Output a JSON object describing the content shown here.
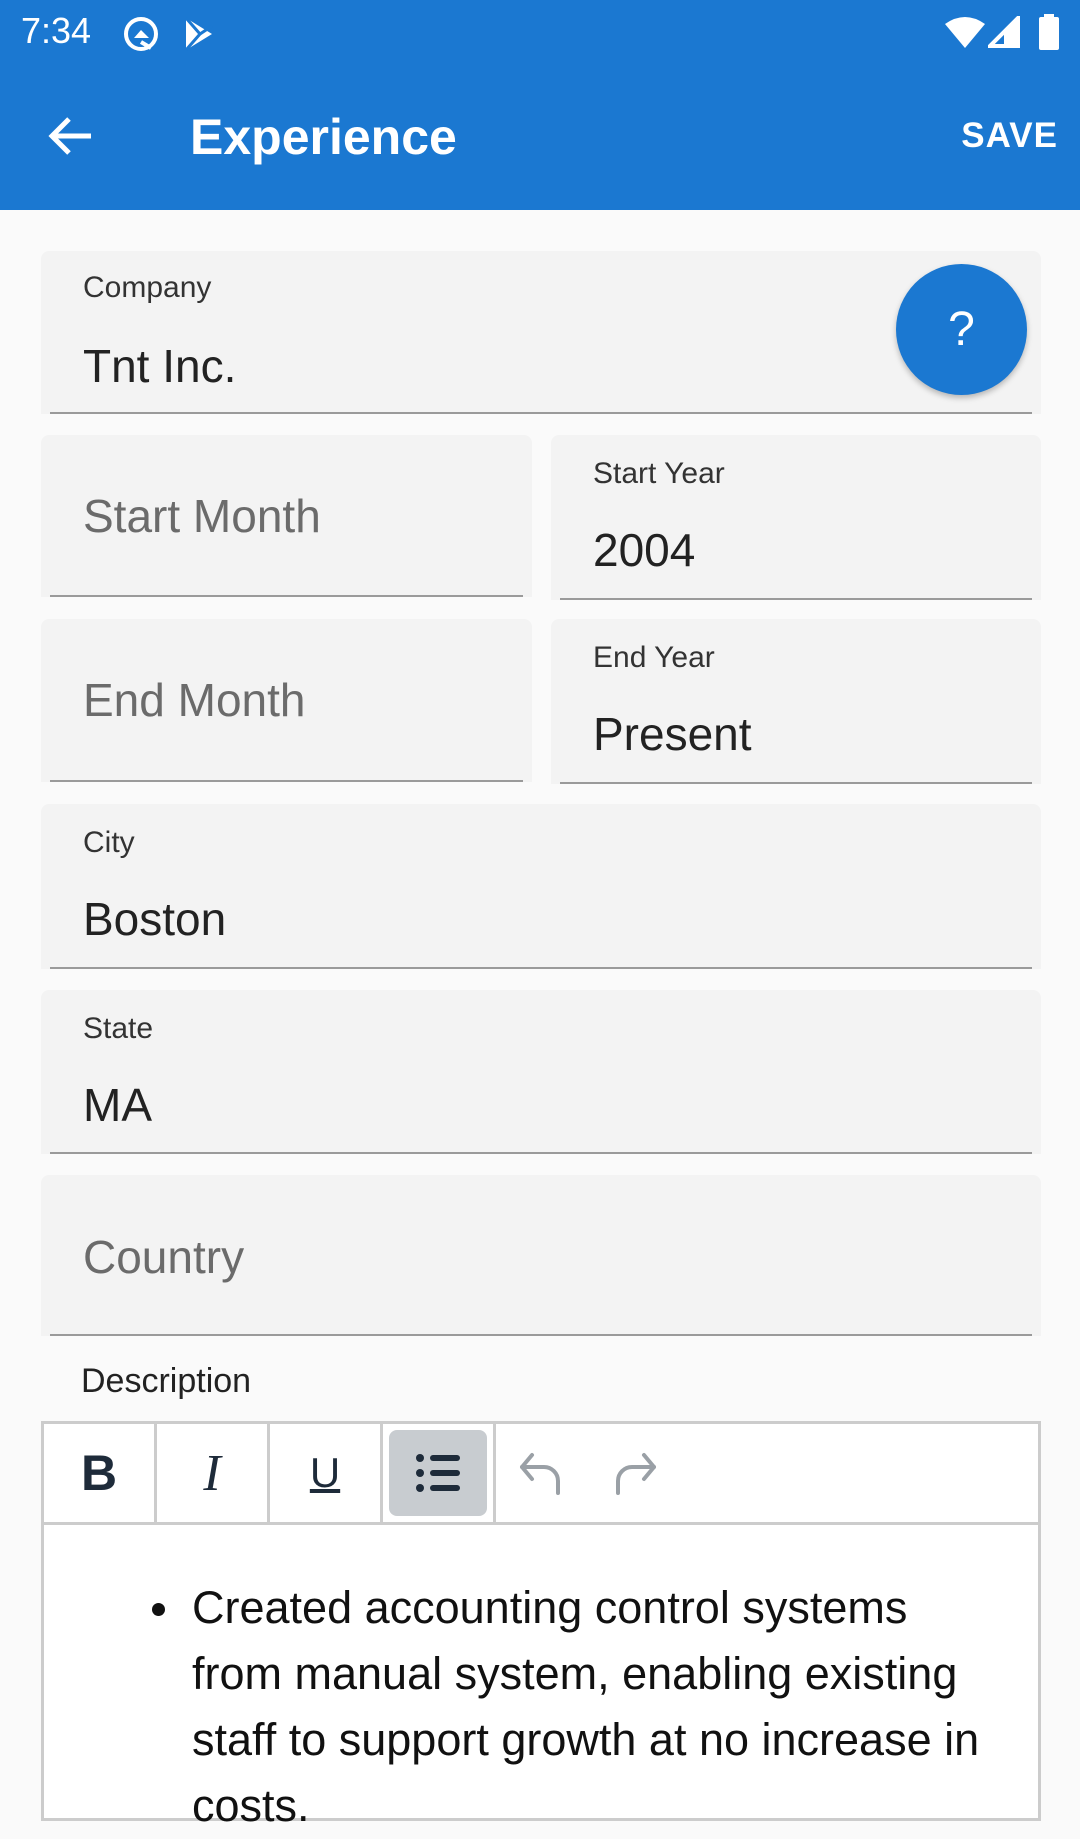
{
  "status_bar": {
    "time": "7:34",
    "left_icons": [
      "q-notification-icon",
      "play-store-icon"
    ],
    "right_icons": [
      "wifi-icon",
      "cell-signal-icon",
      "battery-icon"
    ]
  },
  "app_bar": {
    "title": "Experience",
    "back_icon": "arrow-back-icon",
    "save_label": "SAVE",
    "color": "#1b78d1"
  },
  "form": {
    "company": {
      "label": "Company",
      "value": "Tnt Inc."
    },
    "help_button": {
      "label": "?"
    },
    "start_month": {
      "placeholder": "Start Month",
      "value": ""
    },
    "start_year": {
      "label": "Start Year",
      "value": "2004"
    },
    "end_month": {
      "placeholder": "End Month",
      "value": ""
    },
    "end_year": {
      "label": "End Year",
      "value": "Present"
    },
    "city": {
      "label": "City",
      "value": "Boston"
    },
    "state": {
      "label": "State",
      "value": "MA"
    },
    "country": {
      "placeholder": "Country",
      "value": ""
    }
  },
  "description": {
    "label": "Description",
    "toolbar": {
      "bold": "B",
      "italic": "I",
      "underline": "U",
      "bullet_list_active": true,
      "icons": [
        "bold-icon",
        "italic-icon",
        "underline-icon",
        "bullet-list-icon",
        "undo-icon",
        "redo-icon"
      ]
    },
    "bullets": [
      "Created accounting control systems from manual system, enabling existing staff to support growth at no increase in costs."
    ]
  }
}
